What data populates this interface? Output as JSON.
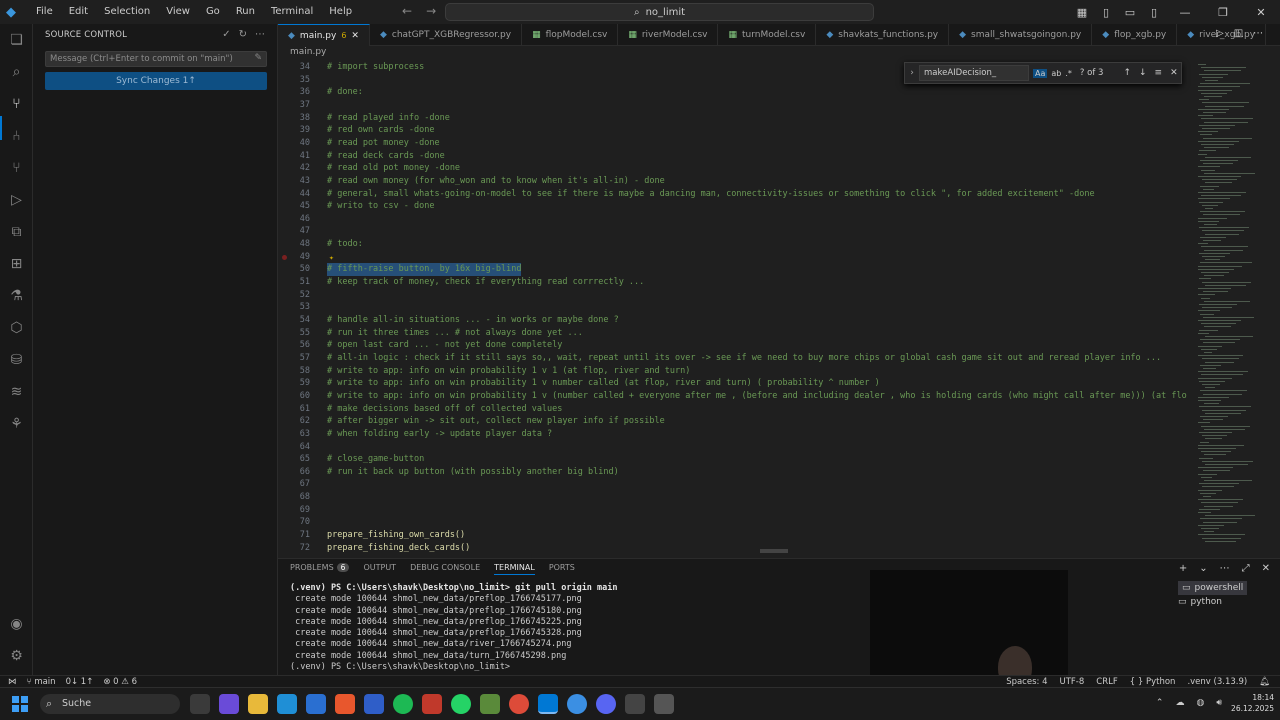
{
  "app": {
    "menu": [
      "File",
      "Edit",
      "Selection",
      "View",
      "Go",
      "Run",
      "Terminal",
      "Help"
    ],
    "search_text": "no_limit"
  },
  "sidebar": {
    "title": "SOURCE CONTROL",
    "commit_placeholder": "Message (Ctrl+Enter to commit on \"main\")",
    "sync_label": "Sync Changes 1↑"
  },
  "tabs": [
    {
      "label": "main.py",
      "badge": "6",
      "active": true
    },
    {
      "label": "chatGPT_XGBRegressor.py"
    },
    {
      "label": "flopModel.csv"
    },
    {
      "label": "riverModel.csv"
    },
    {
      "label": "turnModel.csv"
    },
    {
      "label": "shavkats_functions.py"
    },
    {
      "label": "small_shwatsgoingon.py"
    },
    {
      "label": "flop_xgb.py"
    },
    {
      "label": "river_xgb.py"
    }
  ],
  "breadcrumb": "main.py",
  "find": {
    "query": "makeAIDecision_",
    "opt_case": "Aa",
    "opt_word": "ab",
    "opt_regex": ".*",
    "count": "? of 3"
  },
  "code": [
    {
      "n": "34",
      "t": "# import subprocess"
    },
    {
      "n": "35",
      "t": ""
    },
    {
      "n": "36",
      "t": "# done:"
    },
    {
      "n": "37",
      "t": ""
    },
    {
      "n": "38",
      "t": "# read played info -done"
    },
    {
      "n": "39",
      "t": "# red own cards -done"
    },
    {
      "n": "40",
      "t": "# read pot money -done"
    },
    {
      "n": "41",
      "t": "# read deck cards -done"
    },
    {
      "n": "42",
      "t": "# read old pot money -done"
    },
    {
      "n": "43",
      "t": "# read own money (for who_won and to know when it's all-in) - done"
    },
    {
      "n": "44",
      "t": "# general, small whats-going-on-model to see if there is maybe a dancing man, connectivity-issues or something to click \", for added excitement\" -done"
    },
    {
      "n": "45",
      "t": "# writo to csv - done"
    },
    {
      "n": "46",
      "t": ""
    },
    {
      "n": "47",
      "t": ""
    },
    {
      "n": "48",
      "t": "# todo:"
    },
    {
      "n": "49",
      "t": ""
    },
    {
      "n": "50",
      "t": "# fifth-raise button, by 16x big-blind"
    },
    {
      "n": "51",
      "t": "# keep track of money, check if everything read corrrectly ..."
    },
    {
      "n": "52",
      "t": ""
    },
    {
      "n": "53",
      "t": ""
    },
    {
      "n": "54",
      "t": "# handle all-in situations ... - in works or maybe done ?"
    },
    {
      "n": "55",
      "t": "# run it three times ... # not always done yet ..."
    },
    {
      "n": "56",
      "t": "# open last card ... - not yet done completely"
    },
    {
      "n": "57",
      "t": "# all-in logic : check if it still says so,, wait, repeat until its over -> see if we need to buy more chips or global cash game sit out and reread player info ..."
    },
    {
      "n": "58",
      "t": "# write to app: info on win probability 1 v 1 (at flop, river and turn)"
    },
    {
      "n": "59",
      "t": "# write to app: info on win probability 1 v number called (at flop, river and turn) ( probability ^ number )"
    },
    {
      "n": "60",
      "t": "# write to app: info on win probability 1 v (number called + everyone after me , (before and including dealer , who is holding cards (who might call after me))) (at flo"
    },
    {
      "n": "61",
      "t": "# make decisions based off of collected values"
    },
    {
      "n": "62",
      "t": "# after bigger win -> sit out, collect new player info if possible"
    },
    {
      "n": "63",
      "t": "# when folding early -> update player data ?"
    },
    {
      "n": "64",
      "t": ""
    },
    {
      "n": "65",
      "t": "# close_game-button"
    },
    {
      "n": "66",
      "t": "# run it back up button (with possibly another big blind)"
    },
    {
      "n": "67",
      "t": ""
    },
    {
      "n": "68",
      "t": ""
    },
    {
      "n": "69",
      "t": ""
    },
    {
      "n": "70",
      "t": ""
    },
    {
      "n": "71",
      "t": "prepare_fishing_own_cards()"
    },
    {
      "n": "72",
      "t": "prepare_fishing_deck_cards()"
    }
  ],
  "panel": {
    "tabs": [
      "PROBLEMS",
      "OUTPUT",
      "DEBUG CONSOLE",
      "TERMINAL",
      "PORTS"
    ],
    "problems_count": "6",
    "terminal_lines": [
      "(.venv) PS C:\\Users\\shavk\\Desktop\\no_limit> git pull origin main",
      " create mode 100644 shmol_new_data/preflop_1766745177.png",
      " create mode 100644 shmol_new_data/preflop_1766745180.png",
      " create mode 100644 shmol_new_data/preflop_1766745225.png",
      " create mode 100644 shmol_new_data/preflop_1766745328.png",
      " create mode 100644 shmol_new_data/river_1766745274.png",
      " create mode 100644 shmol_new_data/turn_1766745298.png",
      "(.venv) PS C:\\Users\\shavk\\Desktop\\no_limit> "
    ],
    "terminals": [
      "powershell",
      "python"
    ]
  },
  "status": {
    "branch": "main",
    "sync": "0↓ 1↑",
    "problems": "⊗ 0 ⚠ 6",
    "spaces": "Spaces: 4",
    "encoding": "UTF-8",
    "eol": "CRLF",
    "language": "Python",
    "interpreter": ".venv (3.13.9)"
  },
  "taskbar": {
    "search": "Suche",
    "time": "18:14",
    "date": "26.12.2025"
  },
  "colors": {
    "accent": "#0078d4",
    "comment": "#6a9955",
    "selection": "#264f78"
  }
}
